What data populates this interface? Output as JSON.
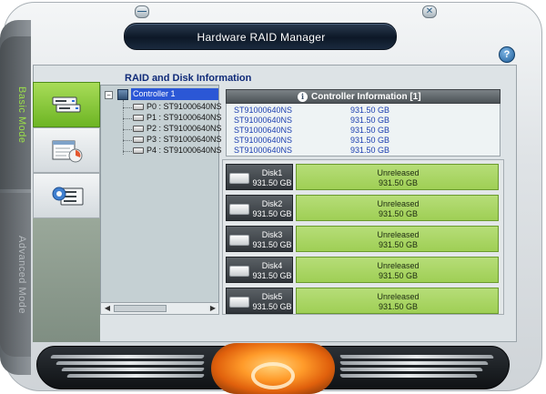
{
  "window": {
    "title": "Hardware RAID Manager",
    "minimize_label": "—",
    "close_label": "✕",
    "help_label": "?"
  },
  "modes": {
    "basic": "Basic Mode",
    "advanced": "Advanced Mode"
  },
  "section_title": "RAID and Disk Information",
  "tabs": [
    {
      "icon": "raid-disk-info-icon",
      "active": true
    },
    {
      "icon": "disk-health-chart-icon",
      "active": false
    },
    {
      "icon": "disk-settings-gear-icon",
      "active": false
    }
  ],
  "tree": {
    "expander": "−",
    "root": "Controller 1",
    "items": [
      "P0 : ST91000640NS",
      "P1 : ST91000640NS",
      "P2 : ST91000640NS",
      "P3 : ST91000640NS",
      "P4 : ST91000640NS"
    ],
    "scroll_left": "◀",
    "scroll_right": "▶"
  },
  "controller_info": {
    "icon_label": "i",
    "title": "Controller Information  [1]",
    "rows": [
      {
        "model": "ST91000640NS",
        "capacity": "931.50 GB"
      },
      {
        "model": "ST91000640NS",
        "capacity": "931.50 GB"
      },
      {
        "model": "ST91000640NS",
        "capacity": "931.50 GB"
      },
      {
        "model": "ST91000640NS",
        "capacity": "931.50 GB"
      },
      {
        "model": "ST91000640NS",
        "capacity": "931.50 GB"
      }
    ]
  },
  "disks": [
    {
      "name": "Disk1",
      "capacity": "931.50 GB",
      "status": "Unreleased",
      "status_capacity": "931.50 GB"
    },
    {
      "name": "Disk2",
      "capacity": "931.50 GB",
      "status": "Unreleased",
      "status_capacity": "931.50 GB"
    },
    {
      "name": "Disk3",
      "capacity": "931.50 GB",
      "status": "Unreleased",
      "status_capacity": "931.50 GB"
    },
    {
      "name": "Disk4",
      "capacity": "931.50 GB",
      "status": "Unreleased",
      "status_capacity": "931.50 GB"
    },
    {
      "name": "Disk5",
      "capacity": "931.50 GB",
      "status": "Unreleased",
      "status_capacity": "931.50 GB"
    }
  ],
  "colors": {
    "accent_green": "#9fcf55",
    "selection_blue": "#2b57d6",
    "info_text_blue": "#1c3fb0",
    "title_bar": "#0d1827",
    "glow_orange": "#ff9b2a"
  }
}
